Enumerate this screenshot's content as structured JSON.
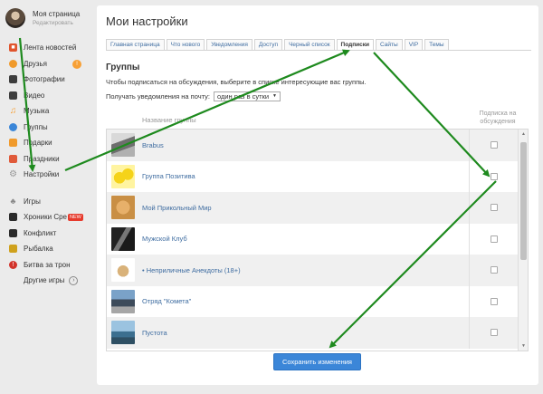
{
  "profile": {
    "name": "Моя страница",
    "edit": "Редактировать"
  },
  "sidebar": {
    "items": [
      {
        "label": "Лента новостей",
        "icon": "news-icon",
        "color": "#e0542c"
      },
      {
        "label": "Друзья",
        "icon": "friends-icon",
        "color": "#f09a2c",
        "badge": "!"
      },
      {
        "label": "Фотографии",
        "icon": "photo-icon",
        "color": "#3d3d3d"
      },
      {
        "label": "Видео",
        "icon": "video-icon",
        "color": "#3d3d3d"
      },
      {
        "label": "Музыка",
        "icon": "music-icon",
        "color": "#f7a035"
      },
      {
        "label": "Группы",
        "icon": "groups-icon",
        "color": "#3b86d8"
      },
      {
        "label": "Подарки",
        "icon": "gift-icon",
        "color": "#f09a2c"
      },
      {
        "label": "Праздники",
        "icon": "calendar-icon",
        "color": "#e05a3a"
      },
      {
        "label": "Настройки",
        "icon": "gear-icon",
        "color": "#999999"
      }
    ],
    "games": [
      {
        "label": "Игры",
        "icon": "games-icon",
        "color": "#888888"
      },
      {
        "label": "Хроники Сре",
        "icon": "chronicles-icon",
        "color": "#2a2a2a",
        "new_badge": "NEW"
      },
      {
        "label": "Конфликт",
        "icon": "conflict-icon",
        "color": "#2a2a2a"
      },
      {
        "label": "Рыбалка",
        "icon": "fishing-icon",
        "color": "#cfa11c"
      },
      {
        "label": "Битва за трон",
        "icon": "battle-icon",
        "color": "#d2332b"
      }
    ],
    "more_games": "Другие игры"
  },
  "main": {
    "title": "Мои настройки",
    "tabs": [
      {
        "label": "Главная страница",
        "active": false
      },
      {
        "label": "Что нового",
        "active": false
      },
      {
        "label": "Уведомления",
        "active": false
      },
      {
        "label": "Доступ",
        "active": false
      },
      {
        "label": "Черный список",
        "active": false
      },
      {
        "label": "Подписки",
        "active": true
      },
      {
        "label": "Сайты",
        "active": false
      },
      {
        "label": "VIP",
        "active": false
      },
      {
        "label": "Темы",
        "active": false
      }
    ],
    "section_title": "Группы",
    "description": "Чтобы подписаться на обсуждения, выберите в списке интересующие вас группы.",
    "notify_label": "Получать уведомления на почту:",
    "notify_value": "один раз в сутки",
    "col_group_name": "Название группы",
    "col_subscription": "Подписка на обсуждения",
    "groups": [
      {
        "name": "Brabus",
        "checked": false
      },
      {
        "name": "Группа Позитива",
        "checked": false
      },
      {
        "name": "Мой Прикольный Мир",
        "checked": false
      },
      {
        "name": "Мужской Клуб",
        "checked": false
      },
      {
        "name": "• Неприличные Анекдоты (18+)",
        "checked": false
      },
      {
        "name": "Отряд \"Комета\"",
        "checked": false
      },
      {
        "name": "Пустота",
        "checked": false
      }
    ],
    "save_button": "Сохранить изменения"
  },
  "colors": {
    "accent": "#3b86d8",
    "link": "#3e6ca0",
    "arrow": "#1e8a1e"
  }
}
